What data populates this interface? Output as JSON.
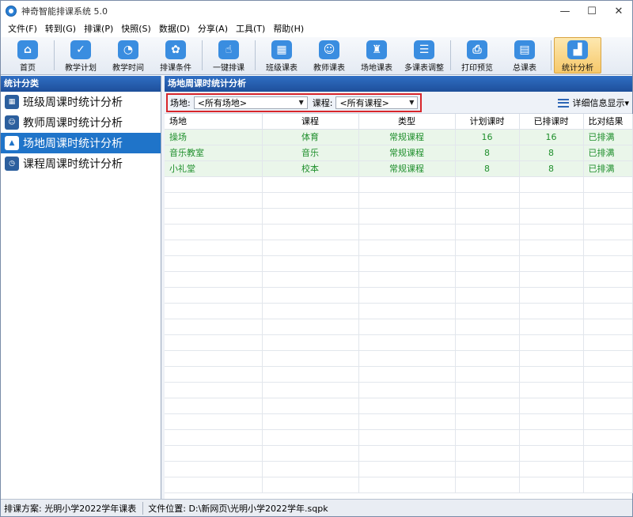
{
  "window": {
    "title": "神奇智能排课系统 5.0",
    "minimize": "—",
    "maximize": "☐",
    "close": "✕"
  },
  "menu": [
    "文件(F)",
    "转到(G)",
    "排课(P)",
    "快照(S)",
    "数据(D)",
    "分享(A)",
    "工具(T)",
    "帮助(H)"
  ],
  "toolbar": [
    {
      "label": "首页",
      "icon": "home-icon"
    },
    {
      "label": "教学计划",
      "icon": "clipboard-icon"
    },
    {
      "label": "教学时间",
      "icon": "clock-icon"
    },
    {
      "label": "排课条件",
      "icon": "conditions-icon"
    },
    {
      "label": "一键排课",
      "icon": "hand-click-icon"
    },
    {
      "label": "班级课表",
      "icon": "calendar-icon"
    },
    {
      "label": "教师课表",
      "icon": "teacher-icon"
    },
    {
      "label": "场地课表",
      "icon": "building-icon"
    },
    {
      "label": "多课表调整",
      "icon": "adjust-icon"
    },
    {
      "label": "打印预览",
      "icon": "printer-icon"
    },
    {
      "label": "总课表",
      "icon": "master-schedule-icon"
    },
    {
      "label": "统计分析",
      "icon": "chart-icon"
    }
  ],
  "left_panel": {
    "title": "统计分类",
    "items": [
      {
        "label": "班级周课时统计分析"
      },
      {
        "label": "教师周课时统计分析"
      },
      {
        "label": "场地周课时统计分析"
      },
      {
        "label": "课程周课时统计分析"
      }
    ],
    "selected_index": 2
  },
  "right_panel": {
    "title": "场地周课时统计分析",
    "filters": {
      "venue_label": "场地:",
      "venue_value": "<所有场地>",
      "course_label": "课程:",
      "course_value": "<所有课程>"
    },
    "detail_button": "详细信息显示▾",
    "columns": [
      "场地",
      "课程",
      "类型",
      "计划课时",
      "已排课时",
      "比对结果"
    ],
    "rows": [
      [
        "操场",
        "体育",
        "常规课程",
        "16",
        "16",
        "已排满"
      ],
      [
        "音乐教室",
        "音乐",
        "常规课程",
        "8",
        "8",
        "已排满"
      ],
      [
        "小礼堂",
        "校本",
        "常规课程",
        "8",
        "8",
        "已排满"
      ]
    ]
  },
  "status": {
    "scheme_label": "排课方案:",
    "scheme_value": "光明小学2022学年课表",
    "file_label": "文件位置:",
    "file_value": "D:\\新网页\\光明小学2022学年.sqpk"
  },
  "colors": {
    "accent": "#1f74c9",
    "table_text": "#1f8f2c",
    "row_bg": "#eaf6ea",
    "highlight_border": "#d8262b"
  }
}
